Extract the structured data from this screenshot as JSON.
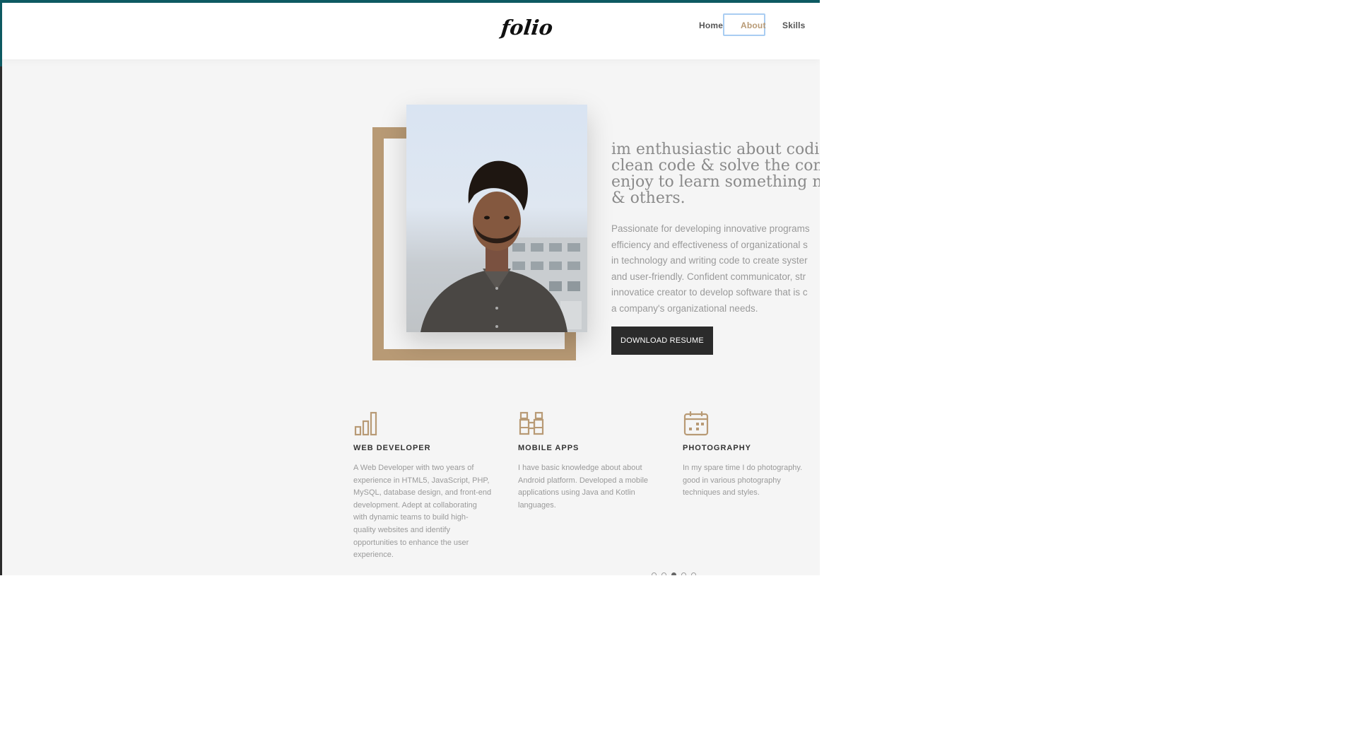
{
  "header": {
    "logo": "folio",
    "nav": [
      {
        "label": "Home"
      },
      {
        "label": "About"
      },
      {
        "label": "Skills"
      }
    ]
  },
  "hero": {
    "heading": "im enthusiastic about coding\nclean code & solve the comp\nenjoy to learn something nev\n& others.",
    "paragraph": "Passionate for developing innovative programs\nefficiency and effectiveness of organizational s\nin technology and writing code to create syster\nand user-friendly. Confident communicator, str\ninnovatice creator to develop software that is c\na company's organizational needs.",
    "button_label": "DOWNLOAD RESUME"
  },
  "services": [
    {
      "icon": "bar-chart-icon",
      "title": "WEB DEVELOPER",
      "text": "A Web Developer with two years of\nexperience in HTML5, JavaScript, PHP,\nMySQL, database design, and front-end\ndevelopment. Adept at collaborating\nwith dynamic teams to build high-\nquality websites and identify\nopportunities to enhance the user\nexperience."
    },
    {
      "icon": "binoculars-icon",
      "title": "MOBILE APPS",
      "text": "I have basic knowledge about about\nAndroid platform. Developed a mobile\napplications using Java and Kotlin\nlanguages."
    },
    {
      "icon": "calendar-icon",
      "title": "PHOTOGRAPHY",
      "text": "In my spare time I do photography.\ngood in various photography\ntechniques and styles."
    }
  ],
  "pager": {
    "count": 5,
    "active": 3
  },
  "colors": {
    "accent": "#b89a75",
    "top_bar": "#0e5b63",
    "button": "#2b2b2b",
    "background": "#f5f5f5"
  }
}
